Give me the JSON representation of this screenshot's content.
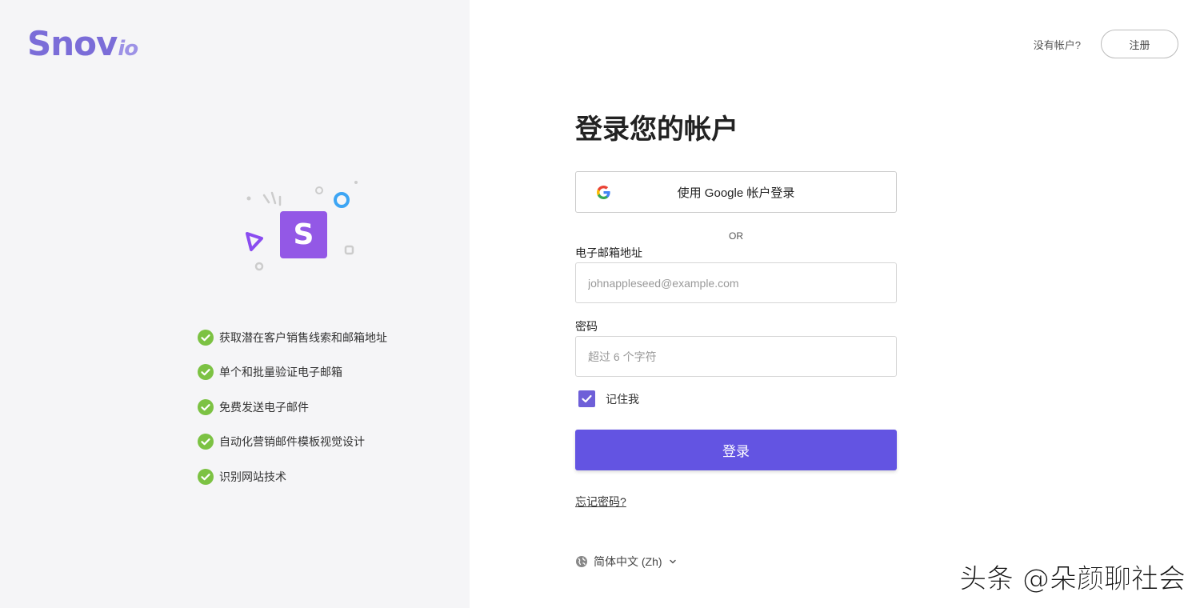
{
  "brand": {
    "name": "Snov",
    "suffix": "io",
    "color": "#7b6dd8"
  },
  "features": [
    "获取潜在客户销售线索和邮箱地址",
    "单个和批量验证电子邮箱",
    "免费发送电子邮件",
    "自动化营销邮件模板视觉设计",
    "识别网站技术"
  ],
  "header": {
    "no_account": "没有帐户?",
    "signup_label": "注册"
  },
  "form": {
    "title": "登录您的帐户",
    "google_label": "使用 Google 帐户登录",
    "or_label": "OR",
    "email_label": "电子邮箱地址",
    "email_placeholder": "johnappleseed@example.com",
    "email_value": "",
    "password_label": "密码",
    "password_placeholder": "超过 6 个字符",
    "password_value": "",
    "remember_label": "记住我",
    "remember_checked": true,
    "login_label": "登录",
    "forgot_label": "忘记密码?"
  },
  "language": {
    "selected": "简体中文 (Zh)"
  },
  "watermark": "头条 @朵颜聊社会",
  "colors": {
    "accent": "#6354e2",
    "check_green": "#7cc243",
    "checkbox": "#6e5fd8"
  }
}
